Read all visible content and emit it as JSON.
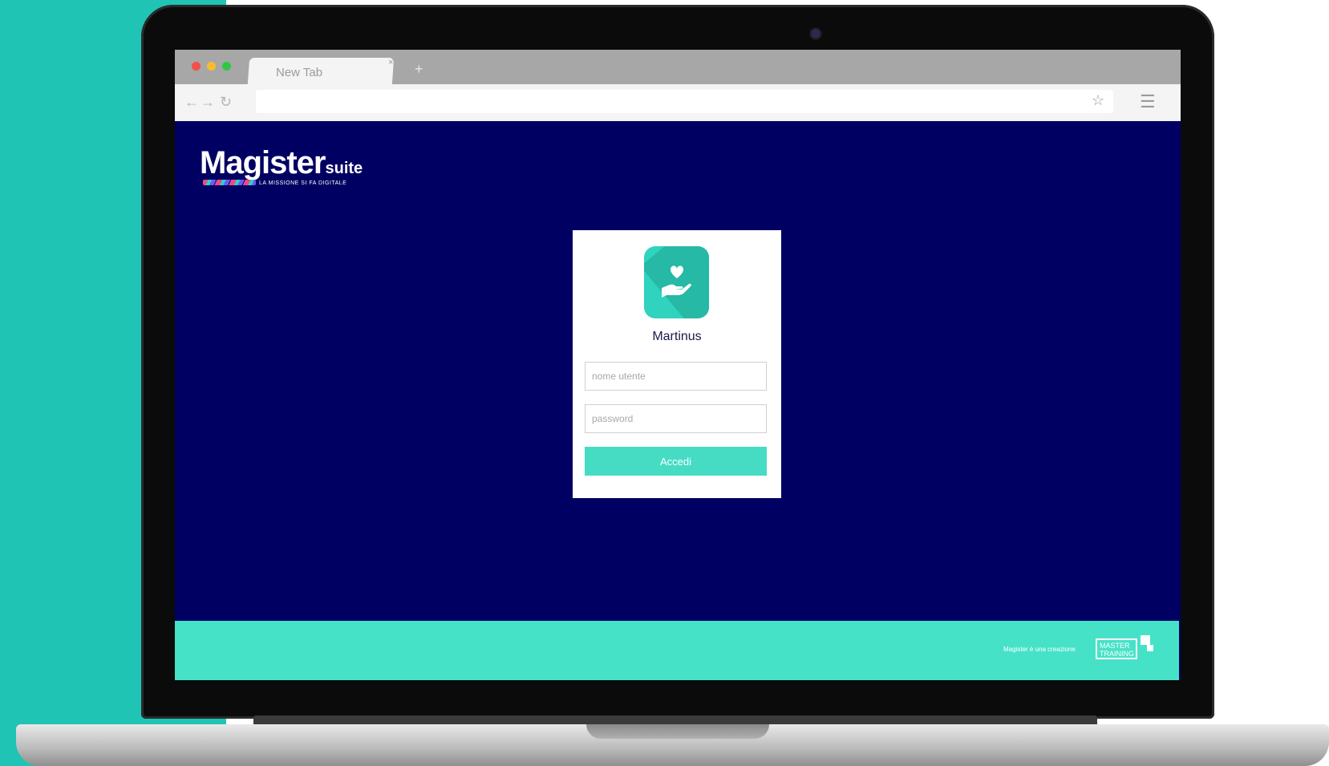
{
  "browser": {
    "tab_label": "New Tab",
    "tab_close": "×",
    "new_tab": "+",
    "back": "←",
    "forward": "→",
    "reload": "↻",
    "star": "☆",
    "menu": "☰"
  },
  "logo": {
    "main": "Magister",
    "suffix": "suite",
    "tagline": "LA MISSIONE SI FA DIGITALE"
  },
  "login": {
    "app_name": "Martinus",
    "username_placeholder": "nome utente",
    "password_placeholder": "password",
    "submit_label": "Accedi"
  },
  "footer": {
    "credit": "Magister è una creazione",
    "brand": "MASTER TRAINING"
  },
  "colors": {
    "page_background": "#000062",
    "accent": "#46dcc4",
    "side_panel": "#1fc4b4"
  },
  "icons": {
    "app_icon": "heart-in-hand-icon"
  }
}
